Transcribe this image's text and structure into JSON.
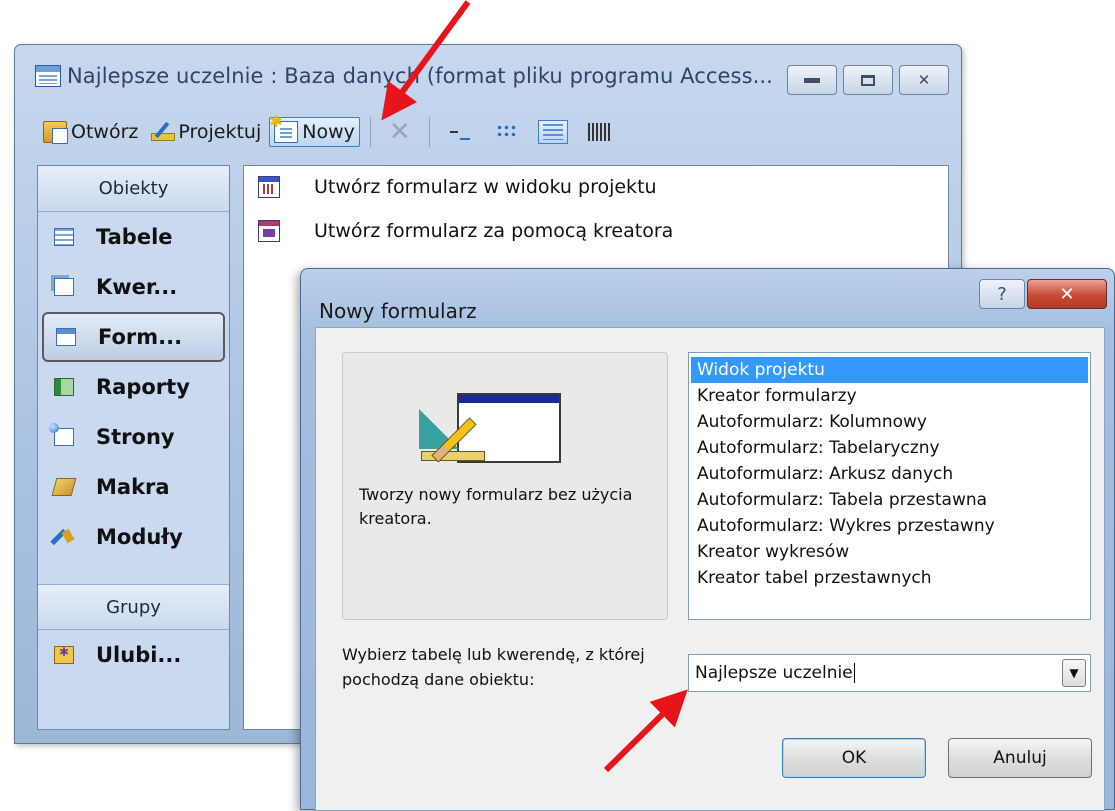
{
  "db_window": {
    "title": "Najlepsze uczelnie : Baza danych (format pliku programu Access...",
    "controls": {
      "minimize": "",
      "maximize": "",
      "close": "✕"
    },
    "toolbar": {
      "open": "Otwórz",
      "design": "Projektuj",
      "new": "Nowy",
      "delete": "✕"
    },
    "objects_bar": {
      "header": "Obiekty",
      "items": [
        {
          "label": "Tabele",
          "icon": "table-icon"
        },
        {
          "label": "Kwer...",
          "icon": "query-icon"
        },
        {
          "label": "Form...",
          "icon": "form-icon",
          "selected": true
        },
        {
          "label": "Raporty",
          "icon": "report-icon"
        },
        {
          "label": "Strony",
          "icon": "page-icon"
        },
        {
          "label": "Makra",
          "icon": "macro-icon"
        },
        {
          "label": "Moduły",
          "icon": "module-icon"
        }
      ],
      "groups_header": "Grupy",
      "groups": [
        {
          "label": "Ulubi...",
          "icon": "favorites-icon"
        }
      ]
    },
    "list": [
      {
        "label": "Utwórz formularz w widoku projektu",
        "icon": "design-view-icon"
      },
      {
        "label": "Utwórz formularz za pomocą kreatora",
        "icon": "wizard-icon"
      }
    ]
  },
  "dialog": {
    "title": "Nowy formularz",
    "help": "?",
    "close": "✕",
    "description": "Tworzy nowy formularz bez użycia kreatora.",
    "types": [
      {
        "label": "Widok projektu",
        "selected": true
      },
      {
        "label": "Kreator formularzy"
      },
      {
        "label": "Autoformularz:  Kolumnowy"
      },
      {
        "label": "Autoformularz:  Tabelaryczny"
      },
      {
        "label": "Autoformularz:  Arkusz danych"
      },
      {
        "label": "Autoformularz: Tabela przestawna"
      },
      {
        "label": "Autoformularz: Wykres przestawny"
      },
      {
        "label": "Kreator wykresów"
      },
      {
        "label": "Kreator tabel przestawnych"
      }
    ],
    "source_label": "Wybierz tabelę lub kwerendę, z której pochodzą dane obiektu:",
    "source_value": "Najlepsze uczelnie",
    "ok": "OK",
    "cancel": "Anuluj"
  },
  "colors": {
    "annotation_arrow": "#e8141b",
    "selection": "#3399ff",
    "close_button": "#c94a34"
  }
}
